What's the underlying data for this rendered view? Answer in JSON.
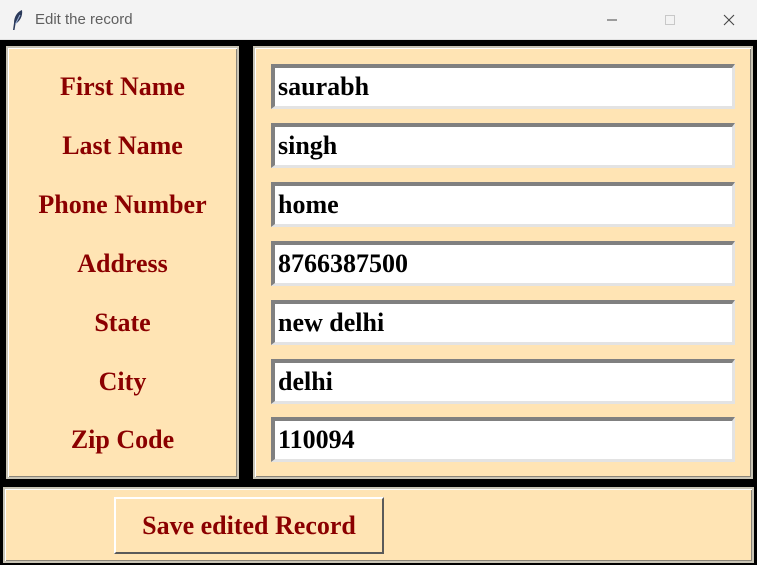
{
  "window": {
    "title": "Edit the record",
    "icon": "feather-icon"
  },
  "form": {
    "labels": [
      "First Name",
      "Last Name",
      "Phone Number",
      "Address",
      "State",
      "City",
      "Zip Code"
    ],
    "values": [
      "saurabh",
      "singh",
      "home",
      "8766387500",
      "new delhi",
      "delhi",
      "110094"
    ]
  },
  "actions": {
    "save_label": "Save edited Record"
  },
  "colors": {
    "panel_bg": "#ffe4b4",
    "label_text": "#8b0000",
    "frame": "#000000"
  }
}
